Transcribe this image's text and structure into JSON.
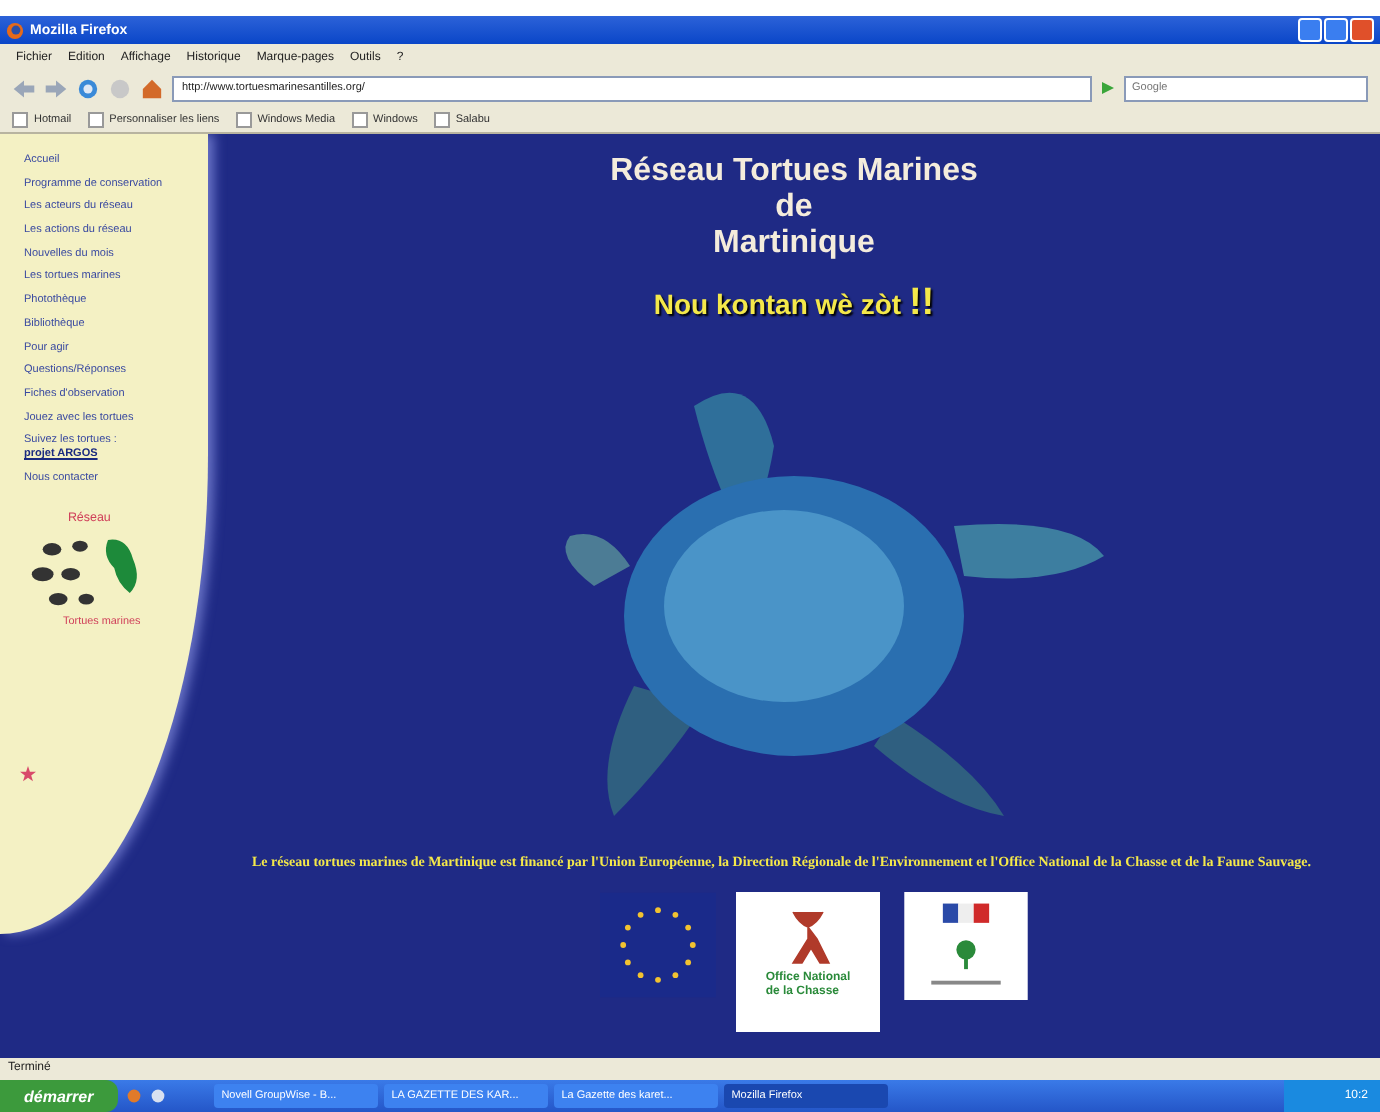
{
  "window": {
    "title": "Mozilla Firefox"
  },
  "menu": [
    "Fichier",
    "Edition",
    "Affichage",
    "Historique",
    "Marque-pages",
    "Outils",
    "?"
  ],
  "address_bar": {
    "value": "http://www.tortuesmarinesantilles.org/"
  },
  "search": {
    "placeholder": "Google"
  },
  "bookmarks": [
    "Hotmail",
    "Personnaliser les liens",
    "Windows Media",
    "Windows",
    "Salabu"
  ],
  "sidebar": {
    "items": [
      {
        "label": "Accueil"
      },
      {
        "label": "Programme de conservation"
      },
      {
        "label": "Les acteurs du réseau"
      },
      {
        "label": "Les actions du réseau"
      },
      {
        "label": "Nouvelles du mois"
      },
      {
        "label": "Les tortues marines"
      },
      {
        "label": "Photothèque"
      },
      {
        "label": "Bibliothèque"
      },
      {
        "label": "Pour agir"
      },
      {
        "label": "Questions/Réponses"
      },
      {
        "label": "Fiches d'observation"
      },
      {
        "label": "Jouez avec les tortues"
      },
      {
        "label": "Suivez les tortues :",
        "link": "projet ARGOS"
      },
      {
        "label": "Nous contacter"
      }
    ],
    "logo": {
      "top": "Réseau",
      "bottom": "Tortues marines"
    }
  },
  "page": {
    "title": [
      "Réseau Tortues Marines",
      "de",
      "Martinique"
    ],
    "tagline": "Nou kontan wè zòt",
    "tagline_mark": "!!",
    "funding": "Le réseau tortues marines de Martinique est financé par l'Union Européenne, la Direction Régionale de l'Environnement et l'Office National de la Chasse et de la Faune Sauvage.",
    "partner_logo_text": [
      "Office National",
      "de la Chasse"
    ]
  },
  "status_bar": "Terminé",
  "taskbar": {
    "start": "démarrer",
    "tasks": [
      {
        "label": "Novell GroupWise - B...",
        "selected": false
      },
      {
        "label": "LA GAZETTE DES KAR...",
        "selected": false
      },
      {
        "label": "La Gazette des karet...",
        "selected": false
      },
      {
        "label": "Mozilla Firefox",
        "selected": true
      }
    ],
    "clock": "10:2"
  }
}
